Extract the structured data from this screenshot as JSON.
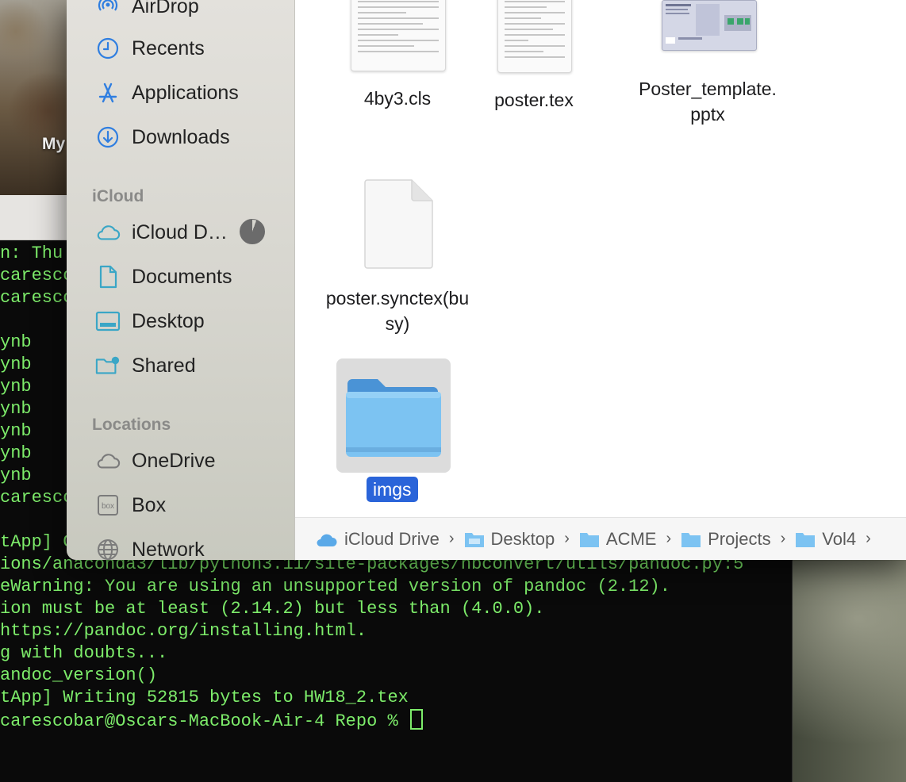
{
  "desktop": {
    "folder_label": "My"
  },
  "terminal": {
    "lines": [
      "n: Thu",
      "caresco",
      "caresco",
      "",
      "ynb",
      "ynb",
      "ynb",
      "ynb",
      "ynb",
      "ynb",
      "ynb",
      "caresco",
      "",
      "tApp] C",
      "ions/anaconda3/lib/python3.11/site-packages/nbconvert/utils/pandoc.py:5",
      "eWarning: You are using an unsupported version of pandoc (2.12).",
      "ion must be at least (2.14.2) but less than (4.0.0).",
      "https://pandoc.org/installing.html.",
      "g with doubts...",
      "andoc_version()",
      "tApp] Writing 52815 bytes to HW18_2.tex",
      "carescobar@Oscars-MacBook-Air-4 Repo % "
    ]
  },
  "finder": {
    "sidebar": {
      "favorites": [
        {
          "label": "AirDrop",
          "icon": "airdrop-icon"
        },
        {
          "label": "Recents",
          "icon": "clock-icon"
        },
        {
          "label": "Applications",
          "icon": "applications-icon"
        },
        {
          "label": "Downloads",
          "icon": "download-icon"
        }
      ],
      "icloud_header": "iCloud",
      "icloud_items": [
        {
          "label": "iCloud D…",
          "icon": "cloud-icon"
        },
        {
          "label": "Documents",
          "icon": "document-icon"
        },
        {
          "label": "Desktop",
          "icon": "desktop-icon"
        },
        {
          "label": "Shared",
          "icon": "shared-folder-icon"
        }
      ],
      "locations_header": "Locations",
      "locations": [
        {
          "label": "OneDrive",
          "icon": "cloud-outline-icon"
        },
        {
          "label": "Box",
          "icon": "box-icon"
        },
        {
          "label": "Network",
          "icon": "globe-icon"
        }
      ]
    },
    "files": [
      {
        "name": "4by3.cls",
        "icon": "document-thumbnail-icon"
      },
      {
        "name": "poster.tex",
        "icon": "document-thumbnail-icon"
      },
      {
        "name_line1": "Poster_template.",
        "name_line2": "pptx",
        "icon": "pptx-thumbnail-icon"
      },
      {
        "name_line1": "poster.synctex(bu",
        "name_line2": "sy)",
        "icon": "blank-document-icon"
      },
      {
        "name": "imgs",
        "icon": "folder-icon",
        "selected": true
      }
    ],
    "pathbar": [
      "iCloud Drive",
      "Desktop",
      "ACME",
      "Projects",
      "Vol4"
    ]
  },
  "colors": {
    "terminal_text": "#7dec6a",
    "selection_blue": "#2a64d9",
    "sidebar_icon_blue": "#2f7ee0",
    "folder_blue": "#6cb8ec"
  }
}
